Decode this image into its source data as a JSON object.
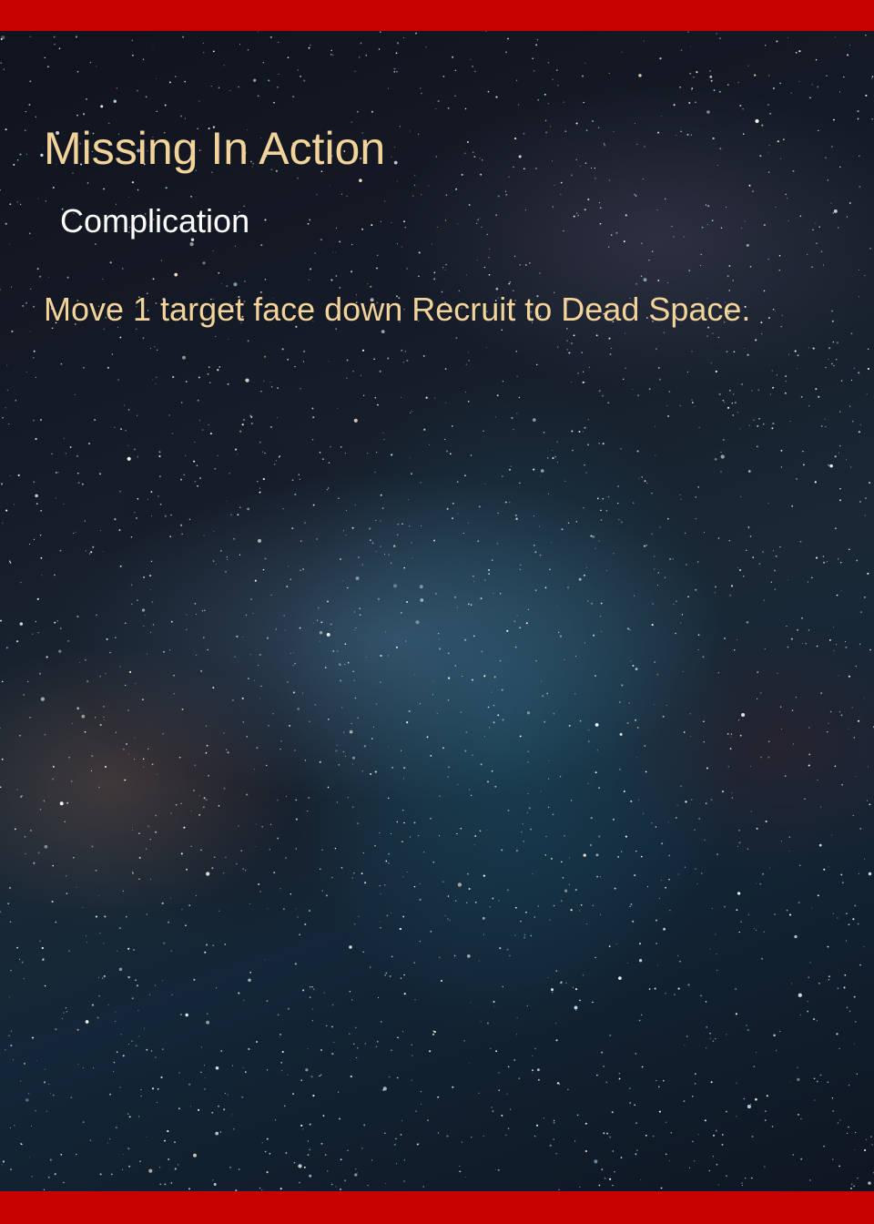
{
  "card": {
    "title": "Missing In Action",
    "type": "Complication",
    "rules_text": "Move 1 target face down Recruit to Dead Space.",
    "colors": {
      "border": "#c70000",
      "title": "#f2d39a",
      "type": "#ffffff",
      "rules": "#f2d39a"
    },
    "background": "starry-night-milky-way"
  }
}
